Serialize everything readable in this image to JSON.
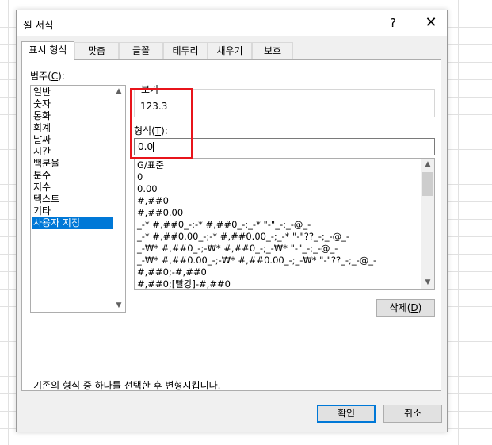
{
  "dialog": {
    "title": "셀 서식",
    "help": "?",
    "close": "✕"
  },
  "tabs": [
    "표시 형식",
    "맞춤",
    "글꼴",
    "테두리",
    "채우기",
    "보호"
  ],
  "active_tab": "표시 형식",
  "category": {
    "label_pre": "범주(",
    "label_key": "C",
    "label_post": "):",
    "items": [
      "일반",
      "숫자",
      "통화",
      "회계",
      "날짜",
      "시간",
      "백분율",
      "분수",
      "지수",
      "텍스트",
      "기타",
      "사용자 지정"
    ],
    "selected": "사용자 지정"
  },
  "sample": {
    "label": "보기",
    "value": "123.3"
  },
  "format_type": {
    "label_pre": "형식(",
    "label_key": "T",
    "label_post": "):",
    "value": "0.0"
  },
  "format_list": [
    "G/표준",
    "0",
    "0.00",
    "#,##0",
    "#,##0.00",
    "_-* #,##0_-;-* #,##0_-;_-* \"-\"_-;_-@_-",
    "_-* #,##0.00_-;-* #,##0.00_-;_-* \"-\"??_-;_-@_-",
    "_-₩* #,##0_-;-₩* #,##0_-;_-₩* \"-\"_-;_-@_-",
    "_-₩* #,##0.00_-;-₩* #,##0.00_-;_-₩* \"-\"??_-;_-@_-",
    "#,##0;-#,##0",
    "#,##0;[빨강]-#,##0"
  ],
  "delete_button": {
    "pre": "삭제(",
    "key": "D",
    "post": ")"
  },
  "description": "기존의 형식 중 하나를 선택한 후 변형시킵니다.",
  "ok_button": "확인",
  "cancel_button": "취소",
  "colors": {
    "selection": "#0078d7",
    "highlight_box": "#e8141b"
  }
}
